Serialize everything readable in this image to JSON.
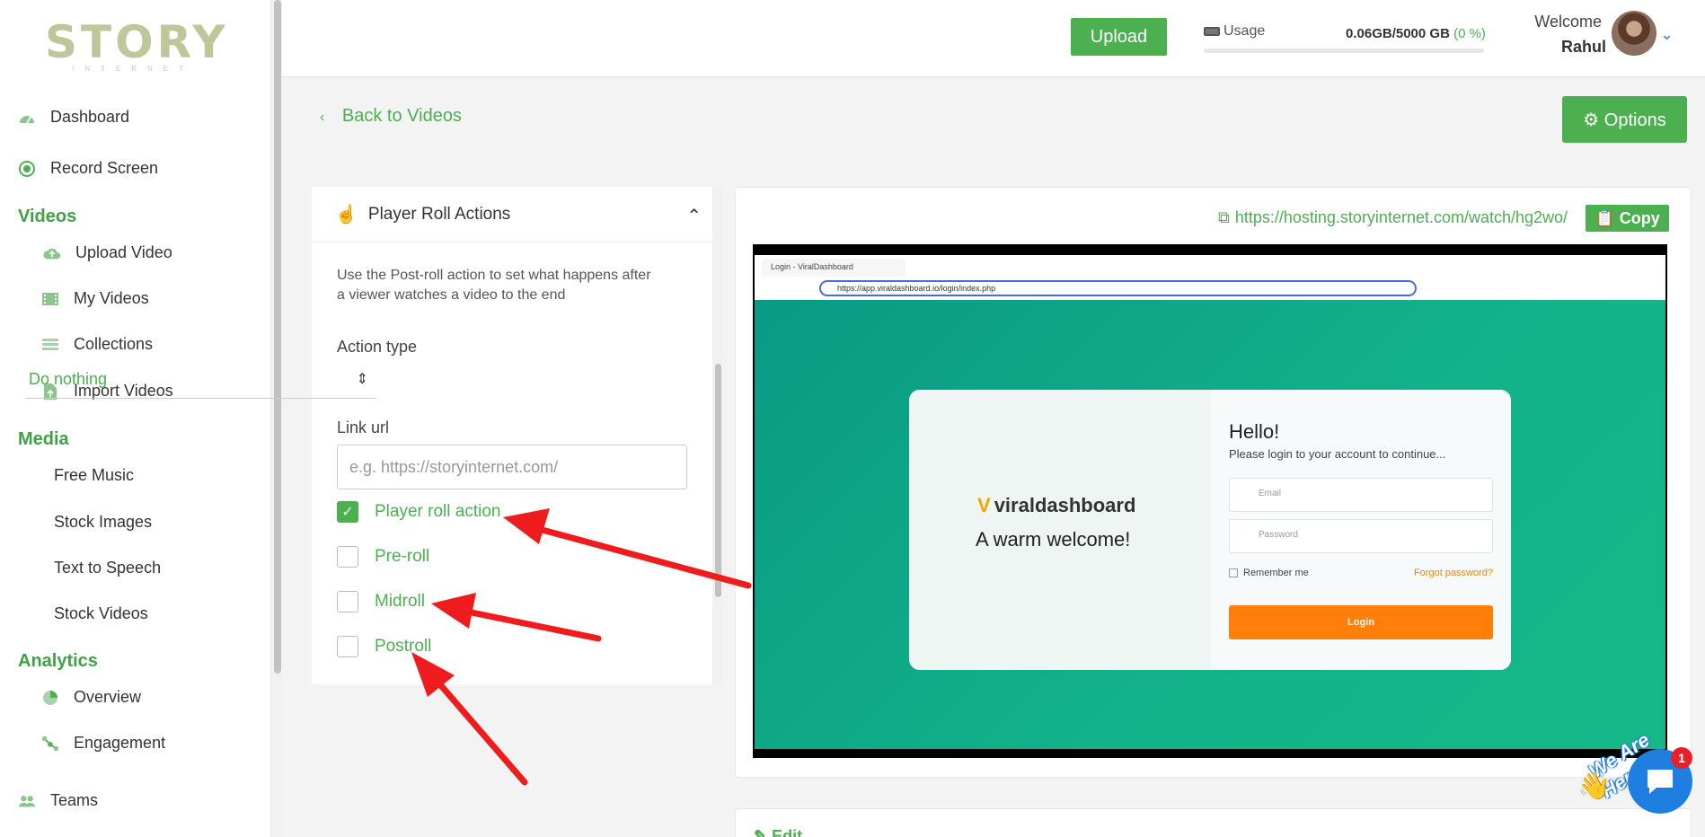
{
  "brand": {
    "logo_text": "STORY",
    "logo_sub": "INTERNET"
  },
  "sidebar": {
    "items": [
      {
        "label": "Dashboard",
        "icon": "dashboard-icon"
      },
      {
        "label": "Record Screen",
        "icon": "record-icon"
      }
    ],
    "sections": [
      {
        "title": "Videos",
        "items": [
          {
            "label": "Upload Video",
            "icon": "cloud-upload-icon"
          },
          {
            "label": "My Videos",
            "icon": "film-icon"
          },
          {
            "label": "Collections",
            "icon": "collections-icon"
          },
          {
            "label": "Import Videos",
            "icon": "import-icon"
          }
        ]
      },
      {
        "title": "Media",
        "items": [
          {
            "label": "Free Music"
          },
          {
            "label": "Stock Images"
          },
          {
            "label": "Text to Speech"
          },
          {
            "label": "Stock Videos"
          }
        ]
      },
      {
        "title": "Analytics",
        "items": [
          {
            "label": "Overview",
            "icon": "pie-chart-icon"
          },
          {
            "label": "Engagement",
            "icon": "engagement-icon"
          }
        ]
      }
    ],
    "teams": {
      "label": "Teams",
      "icon": "users-icon"
    }
  },
  "header": {
    "upload_label": "Upload",
    "usage_label": "Usage",
    "usage_value": "0.06GB/5000 GB",
    "usage_percent": "(0 %)",
    "usage_fraction": 1e-05,
    "welcome": "Welcome",
    "username": "Rahul"
  },
  "main": {
    "back_label": "Back to Videos",
    "options_label": "Options",
    "share_url": "https://hosting.storyinternet.com/watch/hg2wo/",
    "copy_label": "Copy",
    "edit_label": "Edit"
  },
  "panel": {
    "title": "Player Roll Actions",
    "description": "Use the Post-roll action to set what happens after a viewer watches a video to the end",
    "action_type_label": "Action type",
    "action_type_value": "Do nothing",
    "link_url_label": "Link url",
    "link_url_placeholder": "e.g. https://storyinternet.com/",
    "checkboxes": [
      {
        "label": "Player roll action",
        "checked": true
      },
      {
        "label": "Pre-roll",
        "checked": false
      },
      {
        "label": "Midroll",
        "checked": false
      },
      {
        "label": "Postroll",
        "checked": false
      }
    ]
  },
  "video": {
    "tab_title": "Login - ViralDashboard",
    "url": "https://app.viraldashboard.io/login/index.php",
    "brand": "viraldashboard",
    "welcome": "A warm welcome!",
    "hello": "Hello!",
    "subtitle": "Please login to your account to continue...",
    "email_placeholder": "Email",
    "password_placeholder": "Password",
    "remember": "Remember me",
    "forgot": "Forgot password?",
    "login": "Login"
  },
  "chat": {
    "badge": "1",
    "tagline": "We Are Here!"
  },
  "colors": {
    "accent": "#4caf50",
    "arrow": "#ee1c1c",
    "chat": "#1f7fe0"
  }
}
